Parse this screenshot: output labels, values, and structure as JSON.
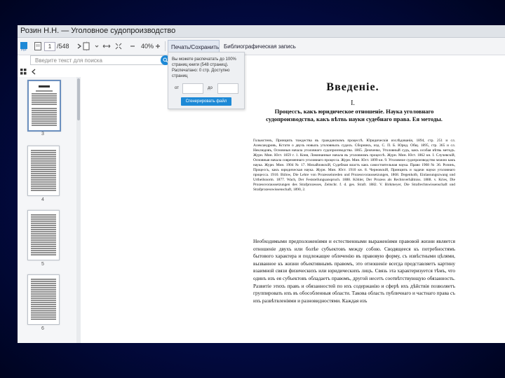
{
  "window": {
    "title": "Розин Н.Н. — Уголовное судопроизводство"
  },
  "toolbar": {
    "page_current": "1",
    "page_total": "/548",
    "zoom": "40%",
    "print_tab": "Печать/Сохранить",
    "bib_tab": "Библиографическая запись"
  },
  "search": {
    "placeholder": "Введите текст для поиска"
  },
  "print_panel": {
    "message": "Вы можете распечатать до 100% страниц книги (548 страниц). Распечатано: 0 стр. Доступно страниц",
    "from_label": "от",
    "to_label": "до",
    "button": "Сгенерировать файл"
  },
  "thumbnails": [
    {
      "label": "3",
      "selected": true
    },
    {
      "label": "4",
      "selected": false
    },
    {
      "label": "5",
      "selected": false
    },
    {
      "label": "6",
      "selected": false
    }
  ],
  "document": {
    "heading": "Введеніе.",
    "section_numeral": "I.",
    "subtitle": "Процессъ, какъ юридическое отношеніе. Наука уголовнаго судопроизводства, какъ вѣтвь науки судебнаго права. Ея методы.",
    "references": "Гольмстенъ, Принципъ тождества въ гражданскомъ процессѣ. Юридическія изслѣдованія, 1894, стр. 251 и сл. Александровъ, Кстати о двухъ новыхъ уголовныхъ судахъ. Сборникъ, изд. С. П. Б. Юрид. Общ. 1895, стр. 365 и сл. Неклюдовъ, Основныя начала уголовнаго судопроизводства. 1865. Демченко, Уголовный судъ, какъ особая вѣтвь методъ. Журн. Мин. Юст. 1859 г. 1. Коня, Ломинанные начала въ уголовномъ процессѣ. Журн. Мин. Юст. 1862 кн. I. Случевскій, Основныя начала современнаго уголовнаго процесса. Журн. Мин. Юст. 1899 кн. 9. Уголовное судопроизводство можно какъ наука. Журн. Мин. 1904 № 17. Михайловскій, Судебная власть какъ самостоятельная наука. Право 1908 № 36. Розинъ, Процессъ, какъ юридическая наука. Журн. Мин. Юст. 1910 кн. 8. Черновскій, Принципъ и задачи науки уголовнаго процесса. 1910. Bülow, Die Lehre von Prozesseinreden und Prozessvoraussetzungen, 1868. Degenkolb, Einlassungszwang und Urtheilsnorm. 1877. Wach, Der Feststellungsanspruch. 1888. Köhler, Der Prozess als Rechtsverhältniss. 1888. v. Kries, Die Prozessvoraussetzungen des Strafprozesses, Zeitschr. f. d. ges. Strafr. 1882. V. Birkmeyer, Die Strafrechtswissenschaft und Strafprozesswissenschaft, 1890, 2.",
    "body": "Необходимыми предположеніями и естественными выраженіями правовой жизни является отношеніе двухъ или болѣе субъектовъ между собою. Сводящееся къ потребностямъ бытового характера и подлежащее облеченію въ правовую форму, съ извѣстными цѣлями, вызванное къ жизни объективнымъ правомъ, это отношеніе всегда представляетъ картину взаимной связи физическихъ или юридическихъ лицъ. Связь эта характеризуется тѣмъ, что одинъ изъ ея субъектовъ обладаетъ правомъ, другой несетъ соотвѣтствующую обязанность. Развитіе этихъ правъ и обязанностей по ихъ содержанію и сферѣ ихъ дѣйствія позволяетъ группировать ихъ въ обособленныя области. Такова область публичнаго и частнаго права съ ихъ развѣтвленіями и разновидностями. Каждая изъ"
  },
  "colors": {
    "accent": "#1d89d6",
    "background": "#020a40"
  }
}
